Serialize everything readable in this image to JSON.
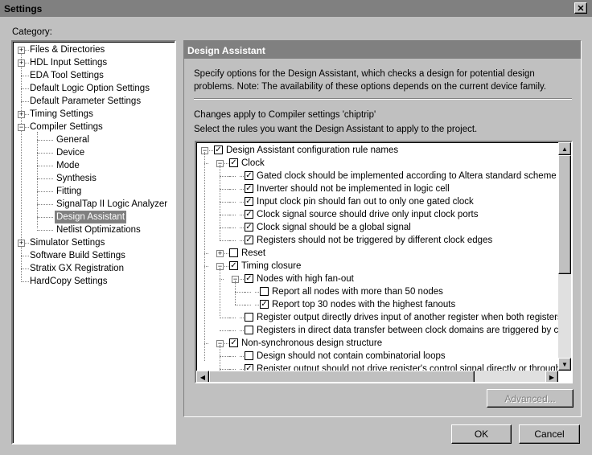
{
  "window": {
    "title": "Settings",
    "close_icon": "close-icon"
  },
  "category_label": "Category:",
  "categories": [
    {
      "label": "Files & Directories",
      "level": 0,
      "expander": "+"
    },
    {
      "label": "HDL Input Settings",
      "level": 0,
      "expander": "+"
    },
    {
      "label": "EDA Tool Settings",
      "level": 0
    },
    {
      "label": "Default Logic Option Settings",
      "level": 0
    },
    {
      "label": "Default Parameter Settings",
      "level": 0
    },
    {
      "label": "Timing Settings",
      "level": 0,
      "expander": "+"
    },
    {
      "label": "Compiler Settings",
      "level": 0,
      "expander": "-"
    },
    {
      "label": "General",
      "level": 1
    },
    {
      "label": "Device",
      "level": 1
    },
    {
      "label": "Mode",
      "level": 1
    },
    {
      "label": "Synthesis",
      "level": 1
    },
    {
      "label": "Fitting",
      "level": 1
    },
    {
      "label": "SignalTap II Logic Analyzer",
      "level": 1
    },
    {
      "label": "Design Assistant",
      "level": 1,
      "selected": true
    },
    {
      "label": "Netlist Optimizations",
      "level": 1
    },
    {
      "label": "Simulator Settings",
      "level": 0,
      "expander": "+"
    },
    {
      "label": "Software Build Settings",
      "level": 0
    },
    {
      "label": "Stratix GX Registration",
      "level": 0
    },
    {
      "label": "HardCopy Settings",
      "level": 0
    }
  ],
  "panel": {
    "title": "Design Assistant",
    "description": "Specify options for the Design Assistant, which checks a design for potential design problems. Note: The availability of these options depends on the current device family.",
    "changes_apply": "Changes apply to Compiler settings 'chiptrip'",
    "select_rules": "Select the rules you want the Design Assistant to apply to the project.",
    "advanced_label": "Advanced..."
  },
  "rules": [
    {
      "label": "Design Assistant configuration rule names",
      "level": 0,
      "checked": true,
      "expander": "-"
    },
    {
      "label": "Clock",
      "level": 1,
      "checked": true,
      "expander": "-"
    },
    {
      "label": "Gated clock should be implemented according to Altera standard scheme",
      "level": 2,
      "checked": true
    },
    {
      "label": "Inverter should not be implemented in logic cell",
      "level": 2,
      "checked": true
    },
    {
      "label": "Input clock pin should fan out to only one gated clock",
      "level": 2,
      "checked": true
    },
    {
      "label": "Clock signal source should drive only input clock ports",
      "level": 2,
      "checked": true
    },
    {
      "label": "Clock signal should be a global signal",
      "level": 2,
      "checked": true
    },
    {
      "label": "Registers should not be triggered by different clock edges",
      "level": 2,
      "checked": true
    },
    {
      "label": "Reset",
      "level": 1,
      "checked": false,
      "expander": "+"
    },
    {
      "label": "Timing closure",
      "level": 1,
      "checked": true,
      "expander": "-"
    },
    {
      "label": "Nodes with high fan-out",
      "level": 2,
      "checked": true,
      "expander": "-"
    },
    {
      "label": "Report all nodes with more than 50 nodes",
      "level": 3,
      "checked": false
    },
    {
      "label": "Report top 30 nodes with the highest fanouts",
      "level": 3,
      "checked": true
    },
    {
      "label": "Register output directly drives input of another register when both registers are triggered",
      "level": 2,
      "checked": false
    },
    {
      "label": "Registers in direct data transfer between clock domains are triggered by clock edges",
      "level": 2,
      "checked": false
    },
    {
      "label": "Non-synchronous design structure",
      "level": 1,
      "checked": true,
      "expander": "-"
    },
    {
      "label": "Design should not contain combinatorial loops",
      "level": 2,
      "checked": false
    },
    {
      "label": "Register output should not drive register's control signal directly or through combinational logic",
      "level": 2,
      "checked": true
    }
  ],
  "buttons": {
    "ok": "OK",
    "cancel": "Cancel"
  }
}
